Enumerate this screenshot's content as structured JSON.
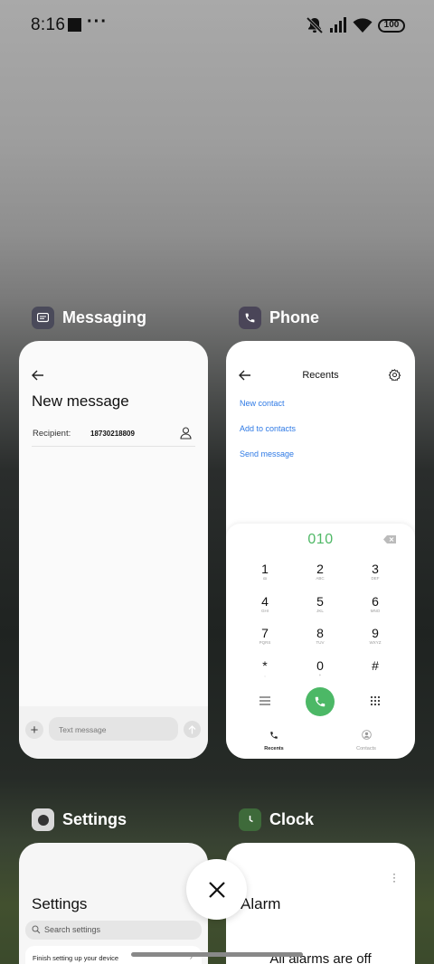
{
  "status_bar": {
    "time": "8:16",
    "overflow_dots": "···",
    "battery": "100"
  },
  "apps": {
    "messaging": {
      "label": "Messaging",
      "title": "New message",
      "recipient_label": "Recipient:",
      "recipient_value": "18730218809",
      "text_placeholder": "Text message",
      "accent": "#4a4a5a"
    },
    "phone": {
      "label": "Phone",
      "title": "Recents",
      "links": [
        "New contact",
        "Add to contacts",
        "Send message"
      ],
      "dialed_number": "010",
      "keys": [
        {
          "digit": "1",
          "letters": "ꝏ"
        },
        {
          "digit": "2",
          "letters": "ABC"
        },
        {
          "digit": "3",
          "letters": "DEF"
        },
        {
          "digit": "4",
          "letters": "GHI"
        },
        {
          "digit": "5",
          "letters": "JKL"
        },
        {
          "digit": "6",
          "letters": "MNO"
        },
        {
          "digit": "7",
          "letters": "PQRS"
        },
        {
          "digit": "8",
          "letters": "TUV"
        },
        {
          "digit": "9",
          "letters": "WXYZ"
        },
        {
          "digit": "*",
          "letters": ","
        },
        {
          "digit": "0",
          "letters": "+"
        },
        {
          "digit": "#",
          "letters": ""
        }
      ],
      "tabs": [
        "Recents",
        "Contacts"
      ],
      "call_color": "#4cb866",
      "link_color": "#2f7ae5"
    },
    "settings": {
      "label": "Settings",
      "title": "Settings",
      "search_placeholder": "Search settings",
      "finish_setup": "Finish setting up your device",
      "chevron": "›"
    },
    "clock": {
      "label": "Clock",
      "title": "Alarm",
      "empty_text": "All alarms are off"
    }
  },
  "close_all": {
    "icon": "close-icon"
  }
}
